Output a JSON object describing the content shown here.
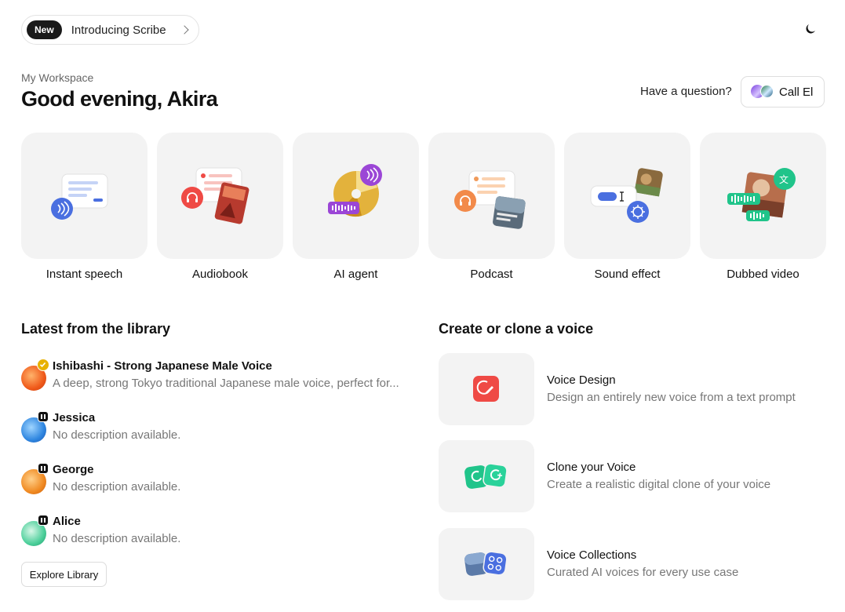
{
  "announcement": {
    "pill": "New",
    "text": "Introducing Scribe"
  },
  "header": {
    "workspace": "My Workspace",
    "greeting": "Good evening, Akira",
    "question": "Have a question?",
    "call_label": "Call El"
  },
  "tiles": [
    {
      "label": "Instant speech"
    },
    {
      "label": "Audiobook"
    },
    {
      "label": "AI agent"
    },
    {
      "label": "Podcast"
    },
    {
      "label": "Sound effect"
    },
    {
      "label": "Dubbed video"
    }
  ],
  "library": {
    "title": "Latest from the library",
    "voices": [
      {
        "name": "Ishibashi - Strong Japanese Male Voice",
        "desc": "A deep, strong Tokyo traditional Japanese male voice, perfect for..."
      },
      {
        "name": "Jessica",
        "desc": "No description available."
      },
      {
        "name": "George",
        "desc": "No description available."
      },
      {
        "name": "Alice",
        "desc": "No description available."
      }
    ],
    "explore": "Explore Library"
  },
  "create": {
    "title": "Create or clone a voice",
    "cards": [
      {
        "title": "Voice Design",
        "desc": "Design an entirely new voice from a text prompt"
      },
      {
        "title": "Clone your Voice",
        "desc": "Create a realistic digital clone of your voice"
      },
      {
        "title": "Voice Collections",
        "desc": "Curated AI voices for every use case"
      }
    ]
  },
  "colors": {
    "accent_blue": "#4a6fe0",
    "accent_red": "#ef4a45",
    "accent_green": "#20c48a",
    "accent_purple": "#9b46d6"
  }
}
